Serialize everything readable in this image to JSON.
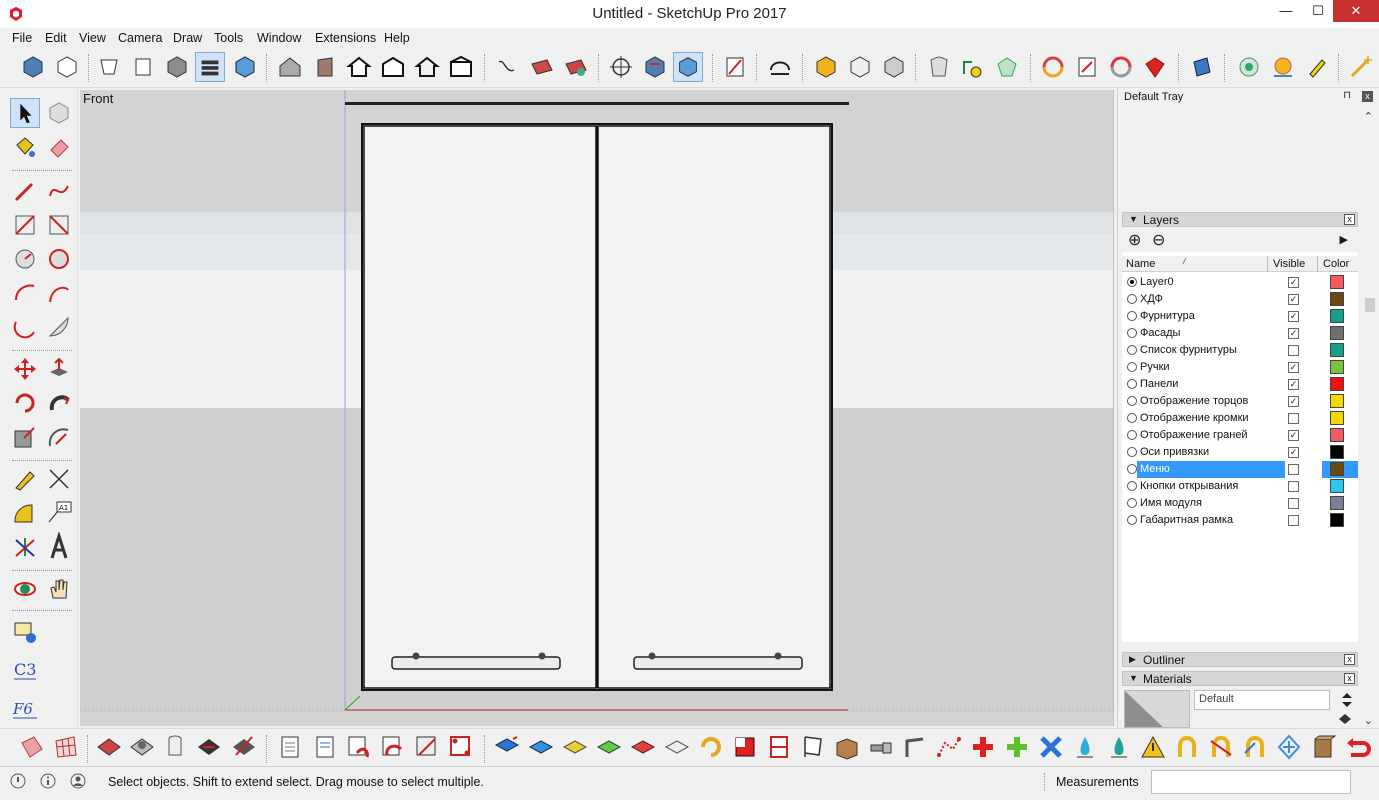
{
  "window": {
    "title": "Untitled - SketchUp Pro 2017",
    "min_glyph": "—",
    "max_glyph": "☐",
    "close_glyph": "✕"
  },
  "menu": [
    "File",
    "Edit",
    "View",
    "Camera",
    "Draw",
    "Tools",
    "Window",
    "Extensions",
    "Help"
  ],
  "viewport": {
    "view_name": "Front"
  },
  "tray": {
    "title": "Default Tray",
    "pin_glyph": "⊓",
    "close_glyph": "x"
  },
  "layers_panel": {
    "title": "Layers",
    "columns": {
      "name": "Name",
      "visible": "Visible",
      "color": "Color"
    },
    "add_glyph": "⊕",
    "remove_glyph": "⊖",
    "details_glyph": "▶",
    "rows": [
      {
        "name": "Layer0",
        "active": true,
        "visible": true,
        "color": "#f25c5c"
      },
      {
        "name": "ХДФ",
        "active": false,
        "visible": true,
        "color": "#6b4a12"
      },
      {
        "name": "Фурнитура",
        "active": false,
        "visible": true,
        "color": "#14a08a"
      },
      {
        "name": "Фасады",
        "active": false,
        "visible": true,
        "color": "#707070"
      },
      {
        "name": "Список фурнитуры",
        "active": false,
        "visible": false,
        "color": "#14a08a"
      },
      {
        "name": "Ручки",
        "active": false,
        "visible": true,
        "color": "#78c23c"
      },
      {
        "name": "Панели",
        "active": false,
        "visible": true,
        "color": "#f01010"
      },
      {
        "name": "Отображение торцов",
        "active": false,
        "visible": true,
        "color": "#f7d700"
      },
      {
        "name": "Отображение кромки",
        "active": false,
        "visible": false,
        "color": "#f7d700"
      },
      {
        "name": "Отображение граней",
        "active": false,
        "visible": true,
        "color": "#f25c5c"
      },
      {
        "name": "Оси привязки",
        "active": false,
        "visible": true,
        "color": "#000000"
      },
      {
        "name": "Меню",
        "active": false,
        "visible": false,
        "color": "#6b4a12",
        "selected": true
      },
      {
        "name": "Кнопки открывания",
        "active": false,
        "visible": false,
        "color": "#2ec4f0"
      },
      {
        "name": "Имя модуля",
        "active": false,
        "visible": false,
        "color": "#7a7f9a"
      },
      {
        "name": "Габаритная рамка",
        "active": false,
        "visible": false,
        "color": "#000000"
      }
    ]
  },
  "outliner_panel": {
    "title": "Outliner"
  },
  "materials_panel": {
    "title": "Materials",
    "current": "Default"
  },
  "status": {
    "hint": "Select objects. Shift to extend select. Drag mouse to select multiple.",
    "measurements_label": "Measurements",
    "measurements_value": ""
  },
  "colors": {
    "selection": "#3399ff",
    "close_red": "#c7312f",
    "viewport_bg": "#d3d3d3"
  }
}
